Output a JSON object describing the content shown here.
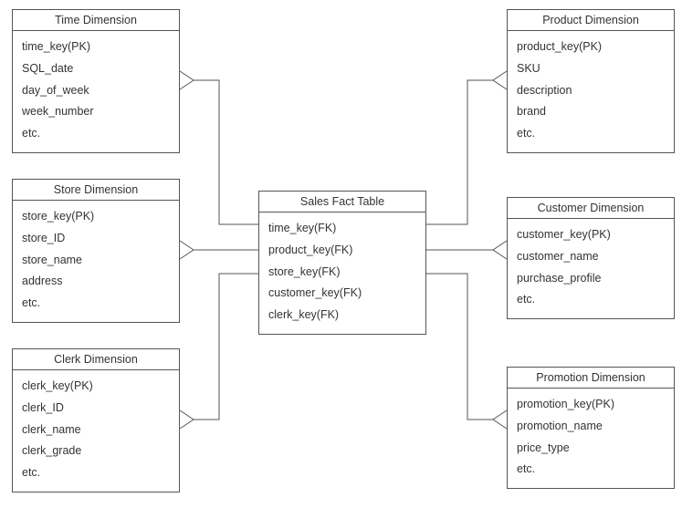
{
  "diagram": {
    "fact": {
      "title": "Sales Fact Table",
      "fields": [
        "time_key(FK)",
        "product_key(FK)",
        "store_key(FK)",
        "customer_key(FK)",
        "clerk_key(FK)"
      ]
    },
    "time": {
      "title": "Time Dimension",
      "fields": [
        "time_key(PK)",
        "SQL_date",
        "day_of_week",
        "week_number",
        "etc."
      ]
    },
    "product": {
      "title": "Product Dimension",
      "fields": [
        "product_key(PK)",
        "SKU",
        "description",
        "brand",
        "etc."
      ]
    },
    "store": {
      "title": "Store Dimension",
      "fields": [
        "store_key(PK)",
        "store_ID",
        "store_name",
        "address",
        "etc."
      ]
    },
    "customer": {
      "title": "Customer Dimension",
      "fields": [
        "customer_key(PK)",
        "customer_name",
        "purchase_profile",
        "etc."
      ]
    },
    "clerk": {
      "title": "Clerk Dimension",
      "fields": [
        "clerk_key(PK)",
        "clerk_ID",
        "clerk_name",
        "clerk_grade",
        "etc."
      ]
    },
    "promotion": {
      "title": "Promotion Dimension",
      "fields": [
        "promotion_key(PK)",
        "promotion_name",
        "price_type",
        "etc."
      ]
    }
  }
}
